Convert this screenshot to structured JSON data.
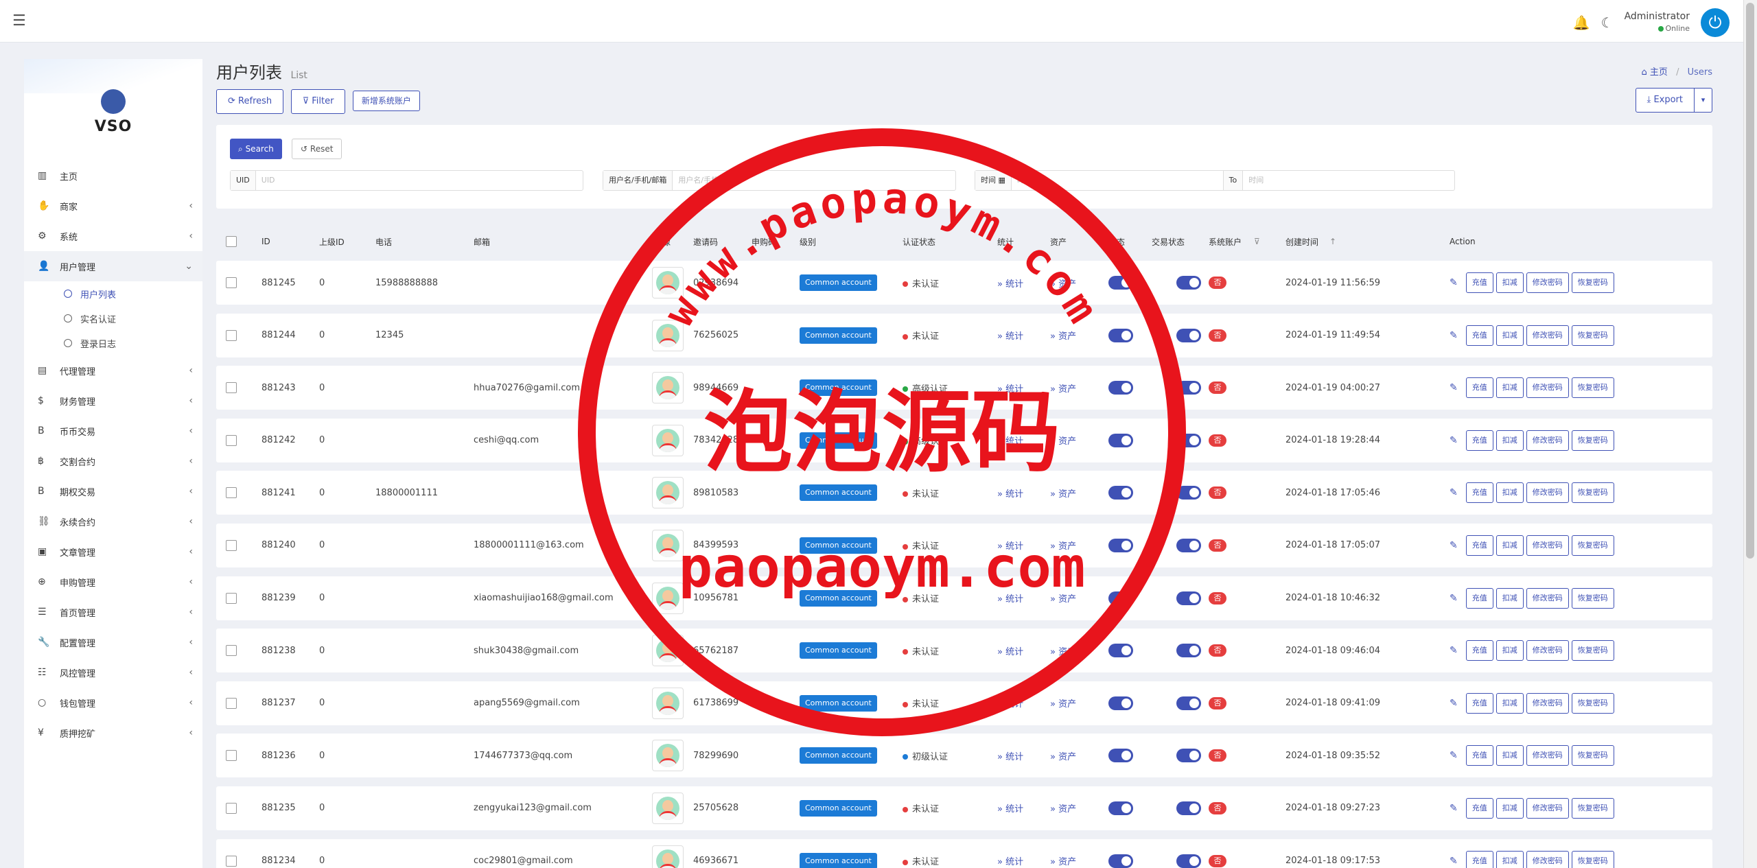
{
  "header": {
    "user_name": "Administrator",
    "user_status": "Online"
  },
  "sidebar": {
    "brand": "VSO",
    "items": [
      {
        "label": "主页",
        "icon": "bar-chart-icon",
        "glyph": "▥",
        "chevron": false
      },
      {
        "label": "商家",
        "icon": "handshake-icon",
        "glyph": "✋",
        "chevron": true
      },
      {
        "label": "系统",
        "icon": "gear-icon",
        "glyph": "⚙",
        "chevron": true
      },
      {
        "label": "用户管理",
        "icon": "user-icon",
        "glyph": "👤",
        "chevron": true,
        "active": true
      }
    ],
    "submenu": [
      {
        "label": "用户列表",
        "current": true
      },
      {
        "label": "实名认证",
        "current": false
      },
      {
        "label": "登录日志",
        "current": false
      }
    ],
    "items_after": [
      {
        "label": "代理管理",
        "icon": "id-card-icon",
        "glyph": "▤"
      },
      {
        "label": "财务管理",
        "icon": "dollar-icon",
        "glyph": "$"
      },
      {
        "label": "币币交易",
        "icon": "bitcoin-icon",
        "glyph": "B"
      },
      {
        "label": "交割合约",
        "icon": "bitcoin-icon",
        "glyph": "฿"
      },
      {
        "label": "期权交易",
        "icon": "bitcoin-icon",
        "glyph": "B"
      },
      {
        "label": "永续合约",
        "icon": "link-icon",
        "glyph": "⛓"
      },
      {
        "label": "文章管理",
        "icon": "newspaper-icon",
        "glyph": "▣"
      },
      {
        "label": "申购管理",
        "icon": "lifebuoy-icon",
        "glyph": "⊕"
      },
      {
        "label": "首页管理",
        "icon": "list-icon",
        "glyph": "☰"
      },
      {
        "label": "配置管理",
        "icon": "wrench-icon",
        "glyph": "🔧"
      },
      {
        "label": "风控管理",
        "icon": "list-icon",
        "glyph": "☷"
      },
      {
        "label": "钱包管理",
        "icon": "circle-icon",
        "glyph": "○"
      },
      {
        "label": "质押挖矿",
        "icon": "yen-icon",
        "glyph": "¥"
      }
    ]
  },
  "page": {
    "title": "用户列表",
    "subtitle": "List",
    "breadcrumb_home": "主页",
    "breadcrumb_current": "Users"
  },
  "toolbar": {
    "refresh": "Refresh",
    "filter": "Filter",
    "new_account": "新增系统账户",
    "export": "Export"
  },
  "filters": {
    "search": "Search",
    "reset": "Reset",
    "uid_label": "UID",
    "uid_placeholder": "UID",
    "user_label": "用户名/手机/邮箱",
    "user_placeholder": "用户名/手机/邮箱",
    "time_label": "时间",
    "time_from_placeholder": "时间",
    "to_label": "To",
    "time_to_placeholder": "时间"
  },
  "table": {
    "columns": [
      "ID",
      "上级ID",
      "电话",
      "邮箱",
      "头像",
      "邀请码",
      "申购码",
      "级别",
      "认证状态",
      "统计",
      "资产",
      "状态",
      "交易状态",
      "系统账户",
      "创建时间",
      "Action"
    ],
    "stat_link": "统计",
    "asset_link": "资产",
    "actions": [
      "充值",
      "扣减",
      "修改密码",
      "恢复密码"
    ],
    "rows": [
      {
        "id": "881245",
        "parent": "0",
        "phone": "15988888888",
        "email": "",
        "invite": "02938694",
        "level": "Common account",
        "auth": "未认证",
        "auth_color": "#e53e3e",
        "system": "否",
        "created": "2024-01-19 11:56:59"
      },
      {
        "id": "881244",
        "parent": "0",
        "phone": "12345",
        "email": "",
        "invite": "76256025",
        "level": "Common account",
        "auth": "未认证",
        "auth_color": "#e53e3e",
        "system": "否",
        "created": "2024-01-19 11:49:54"
      },
      {
        "id": "881243",
        "parent": "0",
        "phone": "",
        "email": "hhua70276@gamil.com",
        "invite": "98944669",
        "level": "Common account",
        "auth": "高级认证",
        "auth_color": "#28a745",
        "system": "否",
        "created": "2024-01-19 04:00:27"
      },
      {
        "id": "881242",
        "parent": "0",
        "phone": "",
        "email": "ceshi@qq.com",
        "invite": "78342028",
        "level": "Common account",
        "auth": "高级认证",
        "auth_color": "#28a745",
        "system": "否",
        "created": "2024-01-18 19:28:44"
      },
      {
        "id": "881241",
        "parent": "0",
        "phone": "18800001111",
        "email": "",
        "invite": "89810583",
        "level": "Common account",
        "auth": "未认证",
        "auth_color": "#e53e3e",
        "system": "否",
        "created": "2024-01-18 17:05:46"
      },
      {
        "id": "881240",
        "parent": "0",
        "phone": "",
        "email": "18800001111@163.com",
        "invite": "84399593",
        "level": "Common account",
        "auth": "未认证",
        "auth_color": "#e53e3e",
        "system": "否",
        "created": "2024-01-18 17:05:07"
      },
      {
        "id": "881239",
        "parent": "0",
        "phone": "",
        "email": "xiaomashuijiao168@gmail.com",
        "invite": "10956781",
        "level": "Common account",
        "auth": "未认证",
        "auth_color": "#e53e3e",
        "system": "否",
        "created": "2024-01-18 10:46:32"
      },
      {
        "id": "881238",
        "parent": "0",
        "phone": "",
        "email": "shuk30438@gmail.com",
        "invite": "65762187",
        "level": "Common account",
        "auth": "未认证",
        "auth_color": "#e53e3e",
        "system": "否",
        "created": "2024-01-18 09:46:04"
      },
      {
        "id": "881237",
        "parent": "0",
        "phone": "",
        "email": "apang5569@gmail.com",
        "invite": "61738699",
        "level": "Common account",
        "auth": "未认证",
        "auth_color": "#e53e3e",
        "system": "否",
        "created": "2024-01-18 09:41:09"
      },
      {
        "id": "881236",
        "parent": "0",
        "phone": "",
        "email": "1744677373@qq.com",
        "invite": "78299690",
        "level": "Common account",
        "auth": "初级认证",
        "auth_color": "#1c7bd6",
        "system": "否",
        "created": "2024-01-18 09:35:52"
      },
      {
        "id": "881235",
        "parent": "0",
        "phone": "",
        "email": "zengyukai123@gmail.com",
        "invite": "25705628",
        "level": "Common account",
        "auth": "未认证",
        "auth_color": "#e53e3e",
        "system": "否",
        "created": "2024-01-18 09:27:23"
      },
      {
        "id": "881234",
        "parent": "0",
        "phone": "",
        "email": "coc29801@gmail.com",
        "invite": "46936671",
        "level": "Common account",
        "auth": "未认证",
        "auth_color": "#e53e3e",
        "system": "否",
        "created": "2024-01-18 09:17:53"
      }
    ]
  },
  "watermark": {
    "arc_text": "www.paopaoym.com",
    "center_text": "泡泡源码",
    "bottom_text": "paopaoym.com",
    "color": "#e8141c"
  }
}
